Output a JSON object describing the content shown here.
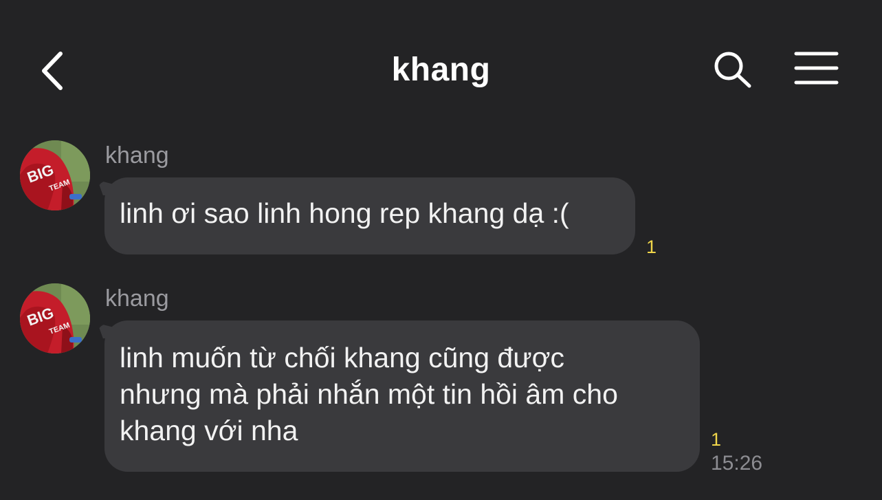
{
  "header": {
    "title": "khang",
    "back_icon": "chevron-left-icon",
    "search_icon": "search-icon",
    "menu_icon": "hamburger-menu-icon"
  },
  "messages": [
    {
      "sender": "khang",
      "text": "linh ơi sao linh hong rep khang dạ :(",
      "unread_count": "1",
      "time": ""
    },
    {
      "sender": "khang",
      "lines": [
        "linh muốn từ chối khang cũng được",
        "nhưng mà phải nhắn một tin hồi âm cho",
        "khang với nha"
      ],
      "unread_count": "1",
      "time": "15:26"
    }
  ],
  "colors": {
    "background": "#232325",
    "bubble": "#3a3a3d",
    "unread": "#f0d64a",
    "muted_text": "#9b9ba0"
  }
}
